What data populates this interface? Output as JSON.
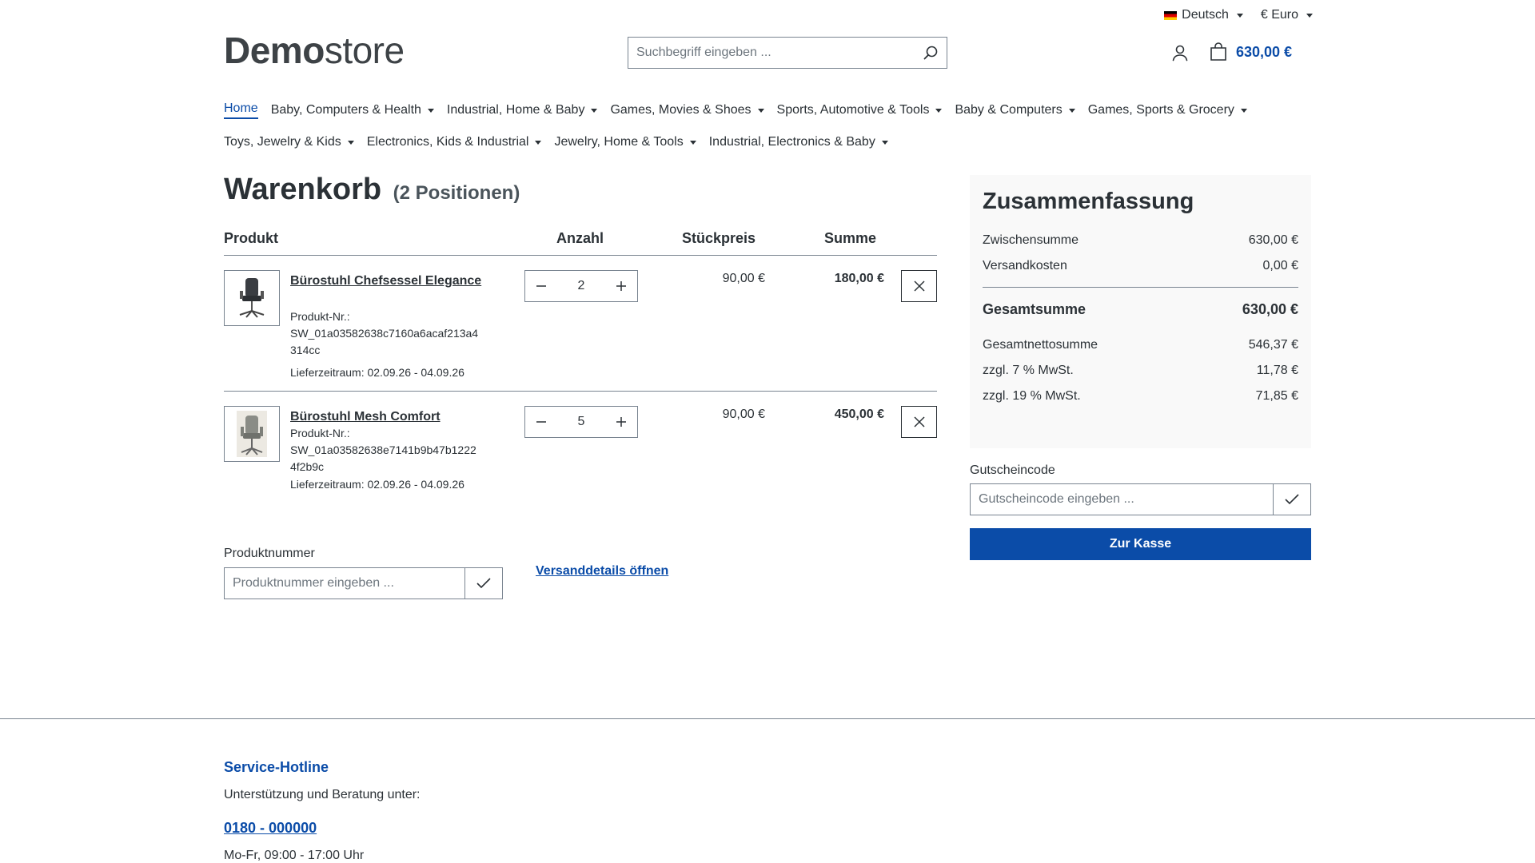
{
  "topbar": {
    "language": "Deutsch",
    "currency": "€ Euro"
  },
  "header": {
    "logo_bold": "Demo",
    "logo_light": "store",
    "search_placeholder": "Suchbegriff eingeben ...",
    "cart_total": "630,00 €"
  },
  "nav": {
    "row1": [
      "Home",
      "Baby, Computers & Health",
      "Industrial, Home & Baby",
      "Games, Movies & Shoes",
      "Sports, Automotive & Tools",
      "Baby & Computers",
      "Games, Sports & Grocery"
    ],
    "row2": [
      "Toys, Jewelry & Kids",
      "Electronics, Kids & Industrial",
      "Jewelry, Home & Tools",
      "Industrial, Electronics & Baby"
    ]
  },
  "cart": {
    "title": "Warenkorb",
    "count": "(2 Positionen)",
    "columns": {
      "product": "Produkt",
      "qty": "Anzahl",
      "unit": "Stückpreis",
      "sum": "Summe"
    },
    "items": [
      {
        "name": "Bürostuhl Chefsessel Elegance",
        "sku_label": "Produkt-Nr.:",
        "sku": "SW_01a03582638c7160a6acaf213a4314cc",
        "delivery": "Lieferzeitraum: 02.09.26 - 04.09.26",
        "qty": "2",
        "unit_price": "90,00 €",
        "total": "180,00 €"
      },
      {
        "name": "Bürostuhl Mesh Comfort",
        "sku_label": "Produkt-Nr.:",
        "sku": "SW_01a03582638e7141b9b47b12224f2b9c",
        "delivery": "Lieferzeitraum: 02.09.26 - 04.09.26",
        "qty": "5",
        "unit_price": "90,00 €",
        "total": "450,00 €"
      }
    ],
    "product_number_label": "Produktnummer",
    "product_number_placeholder": "Produktnummer eingeben ...",
    "shipping_link": "Versanddetails öffnen"
  },
  "summary": {
    "title": "Zusammenfassung",
    "subtotal_label": "Zwischensumme",
    "subtotal": "630,00 €",
    "shipping_label": "Versandkosten",
    "shipping": "0,00 €",
    "total_label": "Gesamtsumme",
    "total": "630,00 €",
    "net_label": "Gesamtnettosumme",
    "net": "546,37 €",
    "vat7_label": "zzgl. 7 % MwSt.",
    "vat7": "11,78 €",
    "vat19_label": "zzgl. 19 % MwSt.",
    "vat19": "71,85 €",
    "voucher_label": "Gutscheincode",
    "voucher_placeholder": "Gutscheincode eingeben ...",
    "checkout": "Zur Kasse"
  },
  "footer": {
    "title": "Service-Hotline",
    "text": "Unterstützung und Beratung unter:",
    "phone": "0180 - 000000",
    "hours": "Mo-Fr, 09:00 - 17:00 Uhr"
  },
  "colors": {
    "accent": "#0b4ca8",
    "text": "#2b3136",
    "border": "#798490",
    "summary_bg": "#f9f9f9"
  }
}
